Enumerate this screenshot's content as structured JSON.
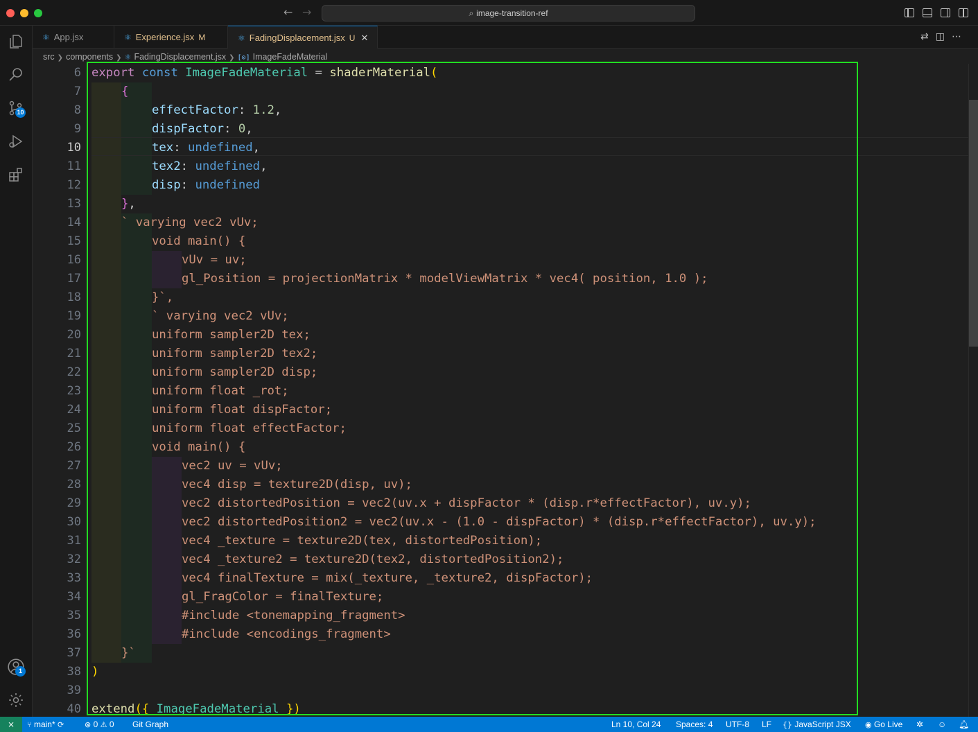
{
  "window": {
    "title": "image-transition-ref",
    "nav_back": "←",
    "nav_forward": "→"
  },
  "activity_bar": {
    "source_control_badge": "10",
    "accounts_badge": "1"
  },
  "tabs": [
    {
      "label": "App.jsx",
      "status": ""
    },
    {
      "label": "Experience.jsx",
      "status": "M"
    },
    {
      "label": "FadingDisplacement.jsx",
      "status": "U"
    }
  ],
  "breadcrumb": {
    "items": [
      "src",
      "components",
      "FadingDisplacement.jsx",
      "ImageFadeMaterial"
    ]
  },
  "editor": {
    "line_numbers": [
      "6",
      "7",
      "8",
      "9",
      "10",
      "11",
      "12",
      "13",
      "14",
      "15",
      "16",
      "17",
      "18",
      "19",
      "20",
      "21",
      "22",
      "23",
      "24",
      "25",
      "26",
      "27",
      "28",
      "29",
      "30",
      "31",
      "32",
      "33",
      "34",
      "35",
      "36",
      "37",
      "38",
      "39",
      "40"
    ],
    "active_line": "10",
    "lines": {
      "l6": [
        "export",
        "const",
        "ImageFadeMaterial",
        " = ",
        "shaderMaterial",
        "("
      ],
      "l7": "{",
      "l8": [
        "effectFactor",
        ": ",
        "1.2",
        ","
      ],
      "l9": [
        "dispFactor",
        ": ",
        "0",
        ","
      ],
      "l10": [
        "tex",
        ": ",
        "undefined",
        ","
      ],
      "l11": [
        "tex2",
        ": ",
        "undefined",
        ","
      ],
      "l12": [
        "disp",
        ": ",
        "undefined"
      ],
      "l13": [
        "}",
        ","
      ],
      "l14": "` varying vec2 vUv;",
      "l15": "void main() {",
      "l16": "vUv = uv;",
      "l17": "gl_Position = projectionMatrix * modelViewMatrix * vec4( position, 1.0 );",
      "l18": "}`,",
      "l19": "` varying vec2 vUv;",
      "l20": "uniform sampler2D tex;",
      "l21": "uniform sampler2D tex2;",
      "l22": "uniform sampler2D disp;",
      "l23": "uniform float _rot;",
      "l24": "uniform float dispFactor;",
      "l25": "uniform float effectFactor;",
      "l26": "void main() {",
      "l27": "vec2 uv = vUv;",
      "l28": "vec4 disp = texture2D(disp, uv);",
      "l29": "vec2 distortedPosition = vec2(uv.x + dispFactor * (disp.r*effectFactor), uv.y);",
      "l30": "vec2 distortedPosition2 = vec2(uv.x - (1.0 - dispFactor) * (disp.r*effectFactor), uv.y);",
      "l31": "vec4 _texture = texture2D(tex, distortedPosition);",
      "l32": "vec4 _texture2 = texture2D(tex2, distortedPosition2);",
      "l33": "vec4 finalTexture = mix(_texture, _texture2, dispFactor);",
      "l34": "gl_FragColor = finalTexture;",
      "l35": "#include <tonemapping_fragment>",
      "l36": "#include <encodings_fragment>",
      "l37": "}`",
      "l38": ")",
      "l39": "",
      "l40": [
        "extend",
        "({",
        "ImageFadeMaterial",
        "})"
      ]
    }
  },
  "status_bar": {
    "branch": "main*",
    "errors": "0",
    "warnings": "0",
    "git_graph": "Git Graph",
    "cursor": "Ln 10, Col 24",
    "spaces": "Spaces: 4",
    "encoding": "UTF-8",
    "eol": "LF",
    "language": "JavaScript JSX",
    "go_live": "Go Live"
  },
  "icons": [
    "explorer-icon",
    "search-icon",
    "source-control-icon",
    "run-debug-icon",
    "extensions-icon",
    "accounts-icon",
    "settings-gear-icon",
    "git-branch-icon",
    "sync-icon",
    "error-icon",
    "warning-icon",
    "broadcast-icon",
    "bell-icon"
  ],
  "colors": {
    "accent": "#0078d4",
    "highlight_frame": "#22dd22",
    "editor_bg": "#1f1f1f",
    "string": "#ce9178",
    "keyword": "#c586c0",
    "declaration": "#569cd6"
  }
}
